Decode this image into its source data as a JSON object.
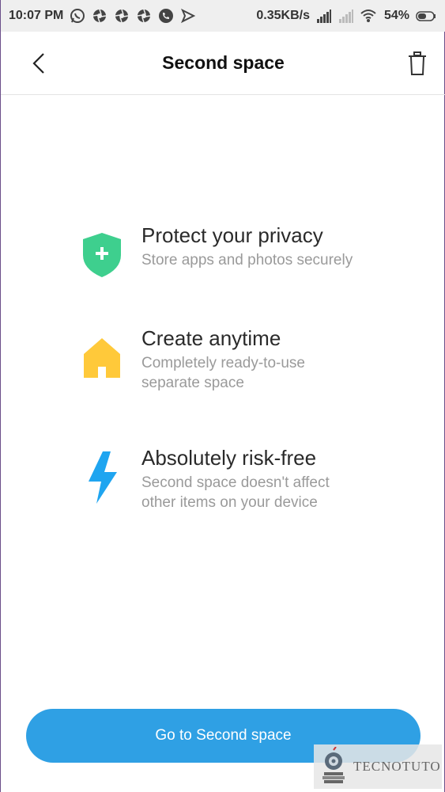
{
  "status_bar": {
    "time": "10:07 PM",
    "network_speed": "0.35KB/s",
    "battery": "54%",
    "icons": [
      "whatsapp-icon",
      "aperture-icon",
      "aperture-icon",
      "aperture-icon",
      "phone-icon",
      "send-icon",
      "signal-icon",
      "signal-empty-icon",
      "wifi-icon",
      "battery-icon"
    ]
  },
  "header": {
    "title": "Second space",
    "back_icon": "chevron-left-icon",
    "trash_icon": "trash-icon"
  },
  "features": [
    {
      "icon": "shield-plus-icon",
      "color": "#3ecf8e",
      "title": "Protect your privacy",
      "description": "Store apps and photos securely"
    },
    {
      "icon": "home-icon",
      "color": "#ffc93a",
      "title": "Create anytime",
      "description": "Completely ready-to-use\nseparate space"
    },
    {
      "icon": "lightning-icon",
      "color": "#1fa5f0",
      "title": "Absolutely risk-free",
      "description": "Second space doesn't affect\nother items on your device"
    }
  ],
  "button": {
    "label": "Go to Second space",
    "color": "#2fa0e4"
  },
  "watermark": {
    "text": "TECNOTUTO"
  }
}
